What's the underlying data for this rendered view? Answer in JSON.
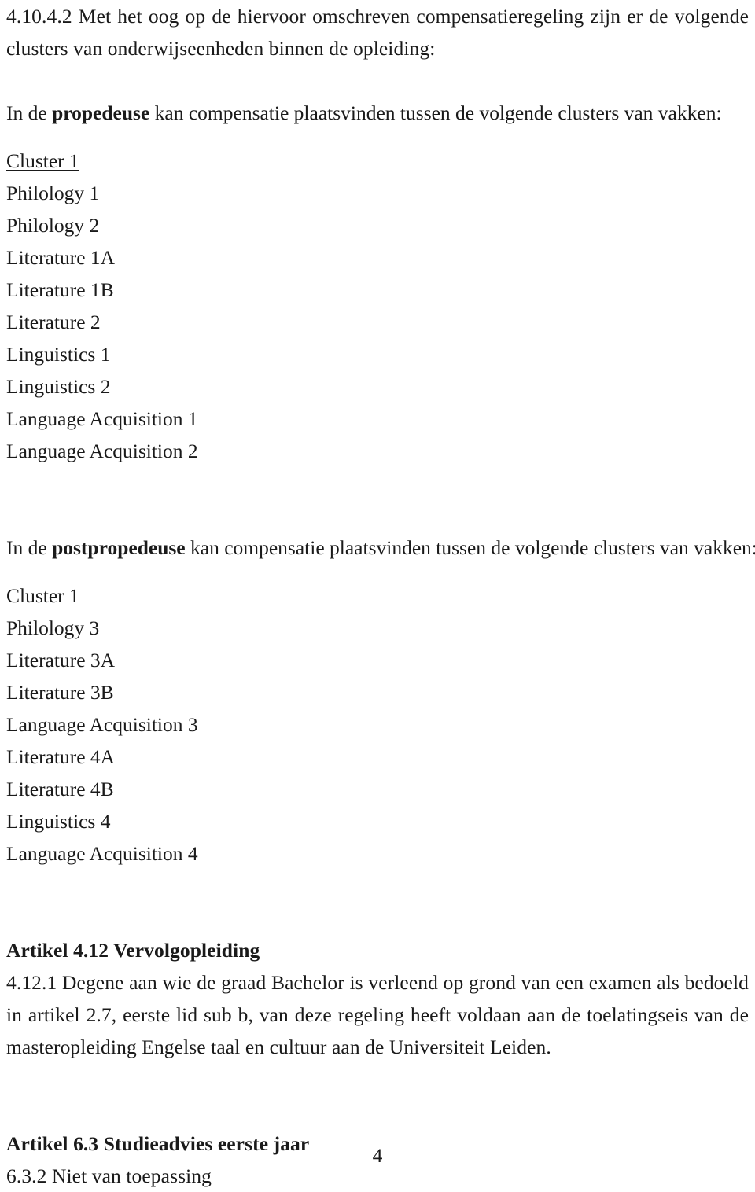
{
  "document": {
    "page_number": "4"
  },
  "intro": {
    "clause_number": "4.10.4.2",
    "paragraph": "4.10.4.2 Met het oog op de hiervoor omschreven compensatieregeling zijn er de volgende clusters van onderwijseenheden binnen de opleiding:"
  },
  "propedeuse": {
    "lead_prefix": "In de ",
    "lead_bold": "propedeuse",
    "lead_suffix": " kan compensatie plaatsvinden tussen de volgende clusters van vakken:",
    "cluster_label": "Cluster 1",
    "courses": [
      "Philology 1",
      "Philology 2",
      "Literature 1A",
      "Literature 1B",
      "Literature 2",
      "Linguistics 1",
      "Linguistics 2",
      "Language Acquisition 1",
      "Language Acquisition 2"
    ]
  },
  "postpropedeuse": {
    "lead_prefix": "In de ",
    "lead_bold": "postpropedeuse",
    "lead_suffix": " kan compensatie plaatsvinden tussen de volgende clusters van vakken:",
    "cluster_label": "Cluster 1",
    "courses": [
      "Philology 3",
      "Literature 3A",
      "Literature 3B",
      "Language Acquisition 3",
      "Literature 4A",
      "Literature 4B",
      "Linguistics 4",
      "Language Acquisition 4"
    ]
  },
  "artikel_412": {
    "heading": "Artikel 4.12 Vervolgopleiding",
    "body": "4.12.1 Degene aan wie de graad Bachelor is verleend op grond van een examen als bedoeld in artikel 2.7, eerste lid sub b, van deze regeling heeft voldaan aan de toelatingseis van de masteropleiding Engelse taal en cultuur aan de Universiteit Leiden."
  },
  "artikel_63": {
    "heading": "Artikel 6.3 Studieadvies eerste jaar",
    "body": "6.3.2 Niet van toepassing"
  }
}
